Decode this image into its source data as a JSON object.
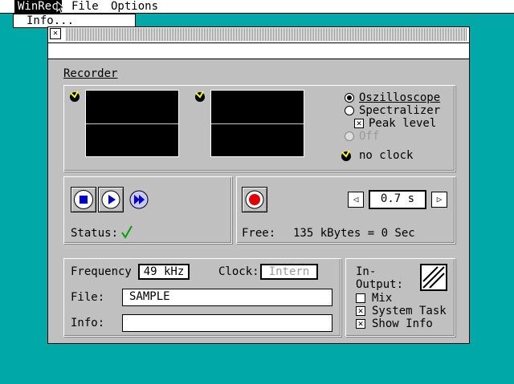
{
  "menubar": {
    "items": [
      "WinRec",
      "File",
      "Options"
    ],
    "dropdown": "Info..."
  },
  "window": {
    "recorder": {
      "label": "Recorder",
      "options": {
        "oszilloscope": "Oszilloscope",
        "spectralizer": "Spectralizer",
        "peak_level": "Peak level",
        "off": "Off"
      },
      "no_clock": "no clock"
    },
    "transport": {
      "status_label": "Status:",
      "status_icon": "check-icon"
    },
    "record": {
      "time": "0.7 s",
      "free_label": "Free:",
      "free_value": "135 kBytes = 0 Sec"
    },
    "settings": {
      "frequency_label": "Frequency",
      "frequency_value": "49 kHz",
      "clock_label": "Clock:",
      "clock_value": "Intern",
      "file_label": "File:",
      "file_value": "SAMPLE",
      "info_label": "Info:",
      "info_value": ""
    },
    "io": {
      "label_line1": "In-",
      "label_line2": "Output:",
      "mix": "Mix",
      "system_task": "System Task",
      "show_info": "Show Info"
    }
  },
  "colors": {
    "desktop": "#00a8a8",
    "window": "#c0c0c0",
    "accent_blue": "#0000c8",
    "record_red": "#e00000",
    "status_green": "#00a000"
  }
}
